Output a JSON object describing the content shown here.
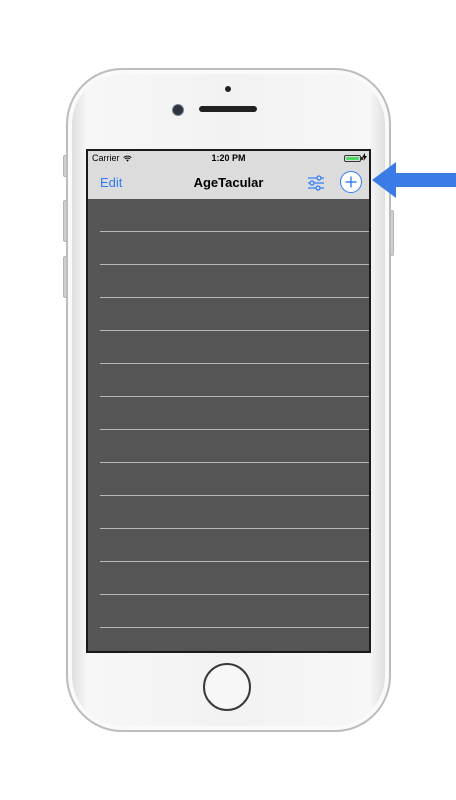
{
  "status_bar": {
    "carrier": "Carrier",
    "time": "1:20 PM",
    "battery_level": 1.0,
    "battery_color": "#4cd964"
  },
  "nav_bar": {
    "edit_label": "Edit",
    "title": "AgeTacular",
    "settings_icon": "sliders-icon",
    "add_icon": "plus-icon",
    "accent_color": "#2f7cf6"
  },
  "table": {
    "row_count": 13,
    "background": "#555555"
  },
  "annotation": {
    "arrow_color": "#3a7be6",
    "arrow_target": "add-button"
  }
}
